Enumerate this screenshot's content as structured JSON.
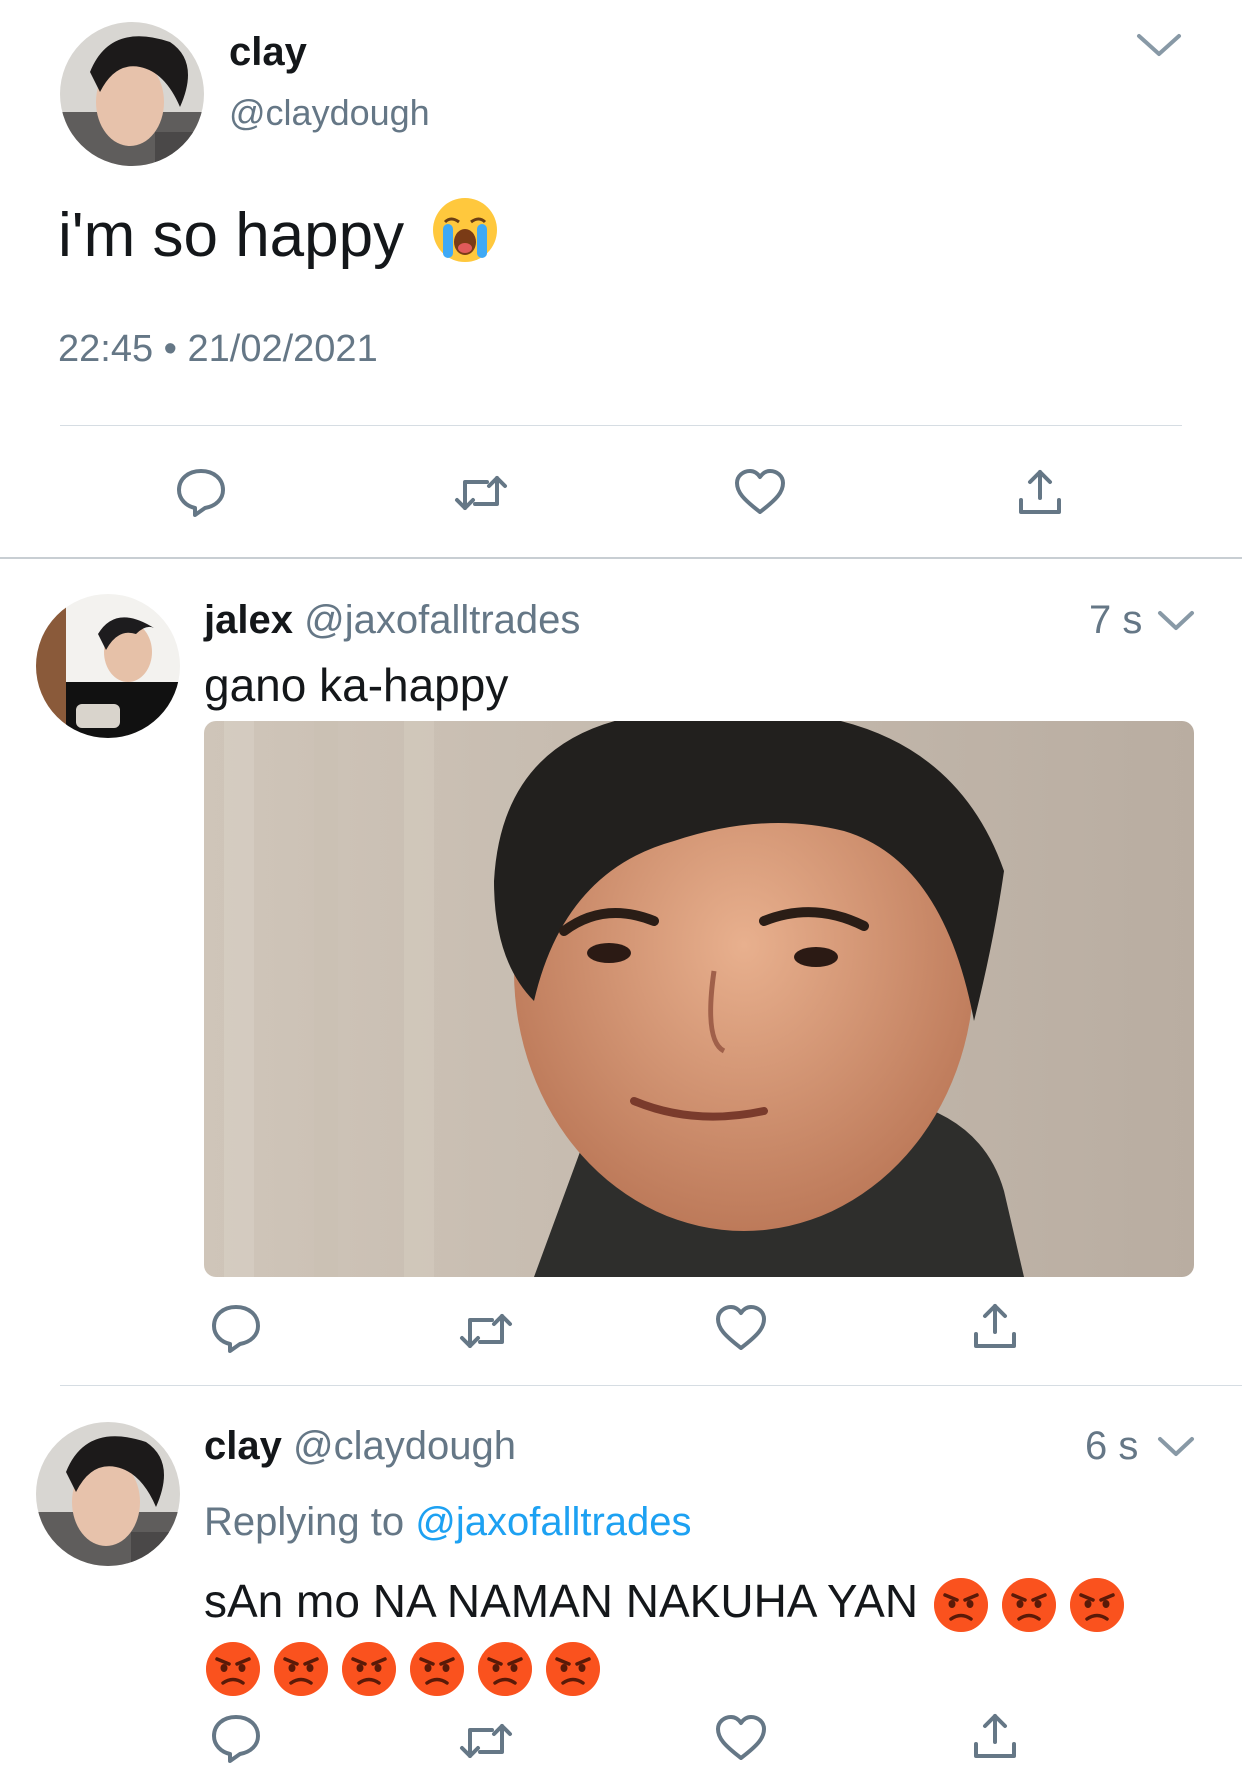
{
  "main_tweet": {
    "name": "clay",
    "handle": "@claydough",
    "text": "i'm so happy",
    "emoji": "loudly-crying-face",
    "timestamp": "22:45 • 21/02/2021"
  },
  "reply1": {
    "name": "jalex",
    "handle": "@jaxofalltrades",
    "time": "7 s",
    "text": "gano ka-happy",
    "media": "photo of smirking young man"
  },
  "reply2": {
    "name": "clay",
    "handle": "@claydough",
    "time": "6 s",
    "replying_prefix": "Replying to",
    "replying_handle": "@jaxofalltrades",
    "text": "sAn mo NA NAMAN NAKUHA YAN",
    "emoji": "angry-face",
    "emoji_count": 9
  },
  "colors": {
    "accent": "#1da1f2",
    "muted": "#657786",
    "icon": "#657786",
    "divider": "#ccd6dd"
  }
}
